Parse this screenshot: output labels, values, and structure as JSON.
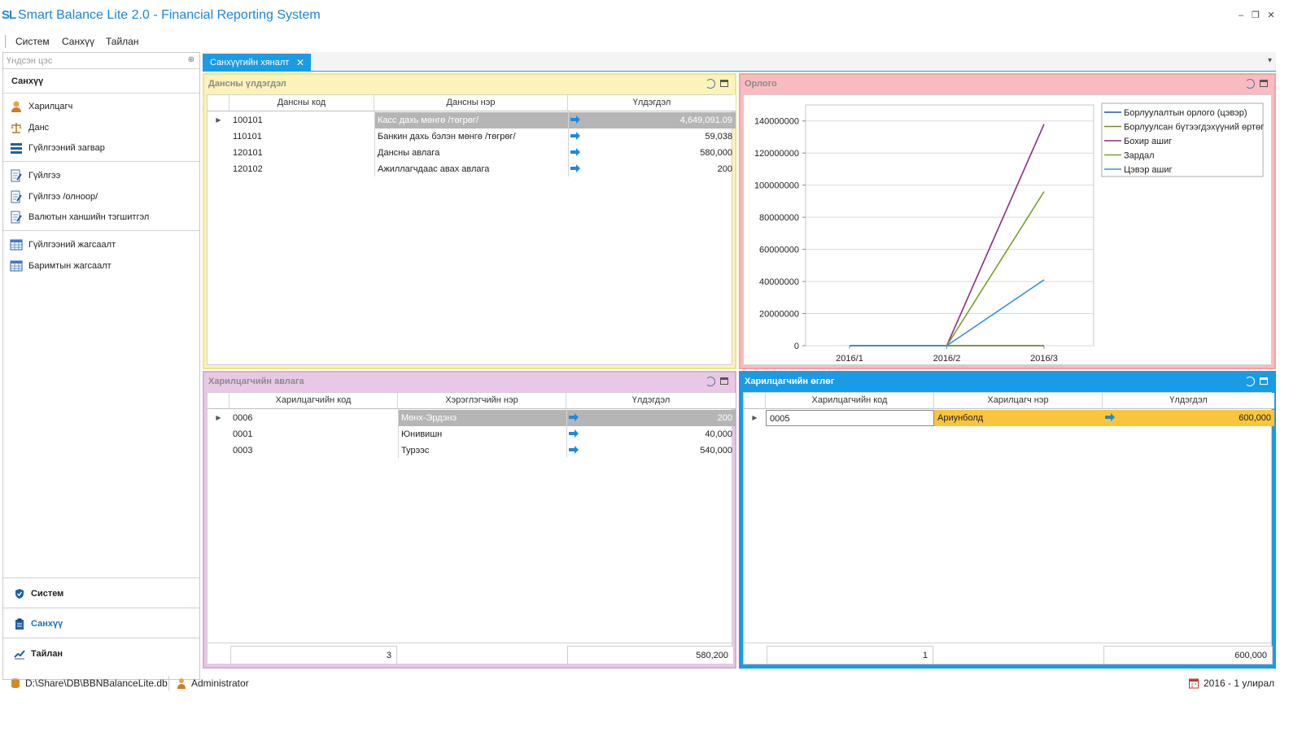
{
  "app": {
    "logo": "SL",
    "title": "Smart Balance Lite 2.0 - Financial Reporting System",
    "win_min": "–",
    "win_restore": "❐",
    "win_close": "✕"
  },
  "menu": [
    "Систем",
    "Санхүү",
    "Тайлан"
  ],
  "sidebar": {
    "header": "Үндсэн цэс",
    "pin": "⊕",
    "group": "Санхүү",
    "items": [
      {
        "label": "Харилцагч",
        "icon": "person-icon"
      },
      {
        "label": "Данс",
        "icon": "scales-icon"
      },
      {
        "label": "Гүйлгээний загвар",
        "icon": "template-icon"
      },
      {
        "label": "Гүйлгээ",
        "icon": "edit-doc-icon"
      },
      {
        "label": "Гүйлгээ /олноор/",
        "icon": "edit-doc-icon"
      },
      {
        "label": "Валютын ханшийн тэгшитгэл",
        "icon": "edit-doc-icon"
      },
      {
        "label": "Гүйлгээний жагсаалт",
        "icon": "table-icon"
      },
      {
        "label": "Баримтын жагсаалт",
        "icon": "table-icon"
      }
    ],
    "bottom": [
      {
        "label": "Систем",
        "icon": "shield-icon"
      },
      {
        "label": "Санхүү",
        "icon": "clipboard-icon"
      },
      {
        "label": "Тайлан",
        "icon": "chart-icon"
      }
    ]
  },
  "tab": {
    "label": "Санхүүгийн хяналт",
    "close": "✕",
    "dropdown": "▾"
  },
  "panels": {
    "balance": {
      "title": "Дансны үлдэгдэл",
      "columns": [
        "Дансны код",
        "Дансны нэр",
        "Үлдэгдэл"
      ],
      "rows": [
        {
          "code": "100101",
          "name": "Касс дахь мөнгө /төгрөг/",
          "value": "4,649,091.09"
        },
        {
          "code": "110101",
          "name": "Банкин дахь бэлэн мөнгө /төгрөг/",
          "value": "59,038"
        },
        {
          "code": "120101",
          "name": "Дансны авлага",
          "value": "580,000"
        },
        {
          "code": "120102",
          "name": "Ажиллагчдаас авах авлага",
          "value": "200"
        }
      ]
    },
    "income": {
      "title": "Орлого"
    },
    "receivable": {
      "title": "Харилцагчийн авлага",
      "columns": [
        "Харилцагчийн код",
        "Хэрэглэгчийн нэр",
        "Үлдэгдэл"
      ],
      "rows": [
        {
          "code": "0006",
          "name": "Мөнх-Эрдэнэ",
          "value": "200"
        },
        {
          "code": "0001",
          "name": "Юнивишн",
          "value": "40,000"
        },
        {
          "code": "0003",
          "name": "Турээс",
          "value": "540,000"
        }
      ],
      "footer_count": "3",
      "footer_total": "580,200"
    },
    "payable": {
      "title": "Харилцагчийн өглөг",
      "columns": [
        "Харилцагчийн код",
        "Харилцагч нэр",
        "Үлдэгдэл"
      ],
      "rows": [
        {
          "code": "0005",
          "name": "Ариунболд",
          "value": "600,000"
        }
      ],
      "footer_count": "1",
      "footer_total": "600,000"
    }
  },
  "chart_data": {
    "type": "line",
    "categories": [
      "2016/1",
      "2016/2",
      "2016/3"
    ],
    "ylim": [
      0,
      150000000
    ],
    "yticks": [
      0,
      20000000,
      40000000,
      60000000,
      80000000,
      100000000,
      120000000,
      140000000
    ],
    "grid": true,
    "legend_position": "top-right",
    "series": [
      {
        "name": "Борлуулалтын орлого (цэвэр)",
        "color": "#1f5fa8",
        "values": [
          0,
          0,
          0
        ]
      },
      {
        "name": "Борлуулсан бүтээгдэхүүний өртөг",
        "color": "#7a8a22",
        "values": [
          0,
          0,
          0
        ]
      },
      {
        "name": "Бохир ашиг",
        "color": "#8a2f7e",
        "values": [
          0,
          0,
          138000000
        ]
      },
      {
        "name": "Зардал",
        "color": "#7aa12a",
        "values": [
          0,
          0,
          96000000
        ]
      },
      {
        "name": "Цэвэр ашиг",
        "color": "#3b8fd4",
        "values": [
          0,
          0,
          41000000
        ]
      }
    ]
  },
  "status": {
    "db": "D:\\Share\\DB\\BBNBalanceLite.db",
    "user": "Administrator",
    "period": "2016 - 1 улирал"
  },
  "colors": {
    "accent": "#1a9be6",
    "balance": "#fbf3b9",
    "income": "#f8bcc0",
    "receivable": "#e9c8e6",
    "payable": "#1a9be6",
    "selected_orange": "#f9c53c"
  }
}
